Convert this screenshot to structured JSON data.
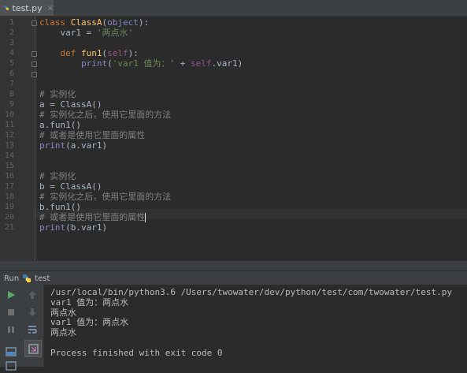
{
  "tab": {
    "filename": "test.py",
    "close": "×"
  },
  "editor": {
    "line_numbers": [
      "1",
      "2",
      "3",
      "4",
      "5",
      "6",
      "7",
      "8",
      "9",
      "10",
      "11",
      "12",
      "13",
      "14",
      "15",
      "16",
      "17",
      "18",
      "19",
      "20",
      "21"
    ],
    "lines": [
      [
        {
          "t": "class ",
          "c": "kw"
        },
        {
          "t": "ClassA",
          "c": "cls"
        },
        {
          "t": "("
        },
        {
          "t": "object",
          "c": "bi"
        },
        {
          "t": "):"
        }
      ],
      [
        {
          "t": "    var1 = "
        },
        {
          "t": "'两点水'",
          "c": "str"
        }
      ],
      [],
      [
        {
          "t": "    "
        },
        {
          "t": "def ",
          "c": "kw"
        },
        {
          "t": "fun1",
          "c": "fn"
        },
        {
          "t": "("
        },
        {
          "t": "self",
          "c": "self"
        },
        {
          "t": "):"
        }
      ],
      [
        {
          "t": "        "
        },
        {
          "t": "print",
          "c": "bi"
        },
        {
          "t": "("
        },
        {
          "t": "'var1 值为：'",
          "c": "str"
        },
        {
          "t": " + "
        },
        {
          "t": "self",
          "c": "self"
        },
        {
          "t": ".var1)"
        }
      ],
      [],
      [],
      [
        {
          "t": "# 实例化",
          "c": "cm"
        }
      ],
      [
        {
          "t": "a = ClassA()"
        }
      ],
      [
        {
          "t": "# 实例化之后，使用它里面的方法",
          "c": "cm"
        }
      ],
      [
        {
          "t": "a.fun1()"
        }
      ],
      [
        {
          "t": "# 或者是使用它里面的属性",
          "c": "cm"
        }
      ],
      [
        {
          "t": "print",
          "c": "bi"
        },
        {
          "t": "(a.var1)"
        }
      ],
      [],
      [],
      [
        {
          "t": "# 实例化",
          "c": "cm"
        }
      ],
      [
        {
          "t": "b = ClassA()"
        }
      ],
      [
        {
          "t": "# 实例化之后，使用它里面的方法",
          "c": "cm"
        }
      ],
      [
        {
          "t": "b.fun1()"
        }
      ],
      [
        {
          "t": "# 或者是使用它里面的属性",
          "c": "cm"
        }
      ],
      [
        {
          "t": "print",
          "c": "bi"
        },
        {
          "t": "(b.var1)"
        }
      ]
    ]
  },
  "run": {
    "label": "Run",
    "config": "test",
    "output": [
      "/usr/local/bin/python3.6 /Users/twowater/dev/python/test/com/twowater/test.py",
      "var1 值为：两点水",
      "两点水",
      "var1 值为：两点水",
      "两点水",
      "",
      "Process finished with exit code 0"
    ]
  },
  "icons": {
    "tab": "python-file-icon",
    "run_tools": [
      "run-icon",
      "scroll-up-icon",
      "stop-icon",
      "scroll-down-icon",
      "pause-icon",
      "soft-wrap-icon",
      "layout-icon",
      "print-icon",
      "terminal-icon"
    ]
  },
  "colors": {
    "background": "#2b2b2b",
    "keyword": "#cc7832",
    "function": "#ffc66d",
    "string": "#6a8759",
    "comment": "#808080",
    "builtin": "#8888c6",
    "self": "#94558d",
    "run_green": "#59a869"
  }
}
